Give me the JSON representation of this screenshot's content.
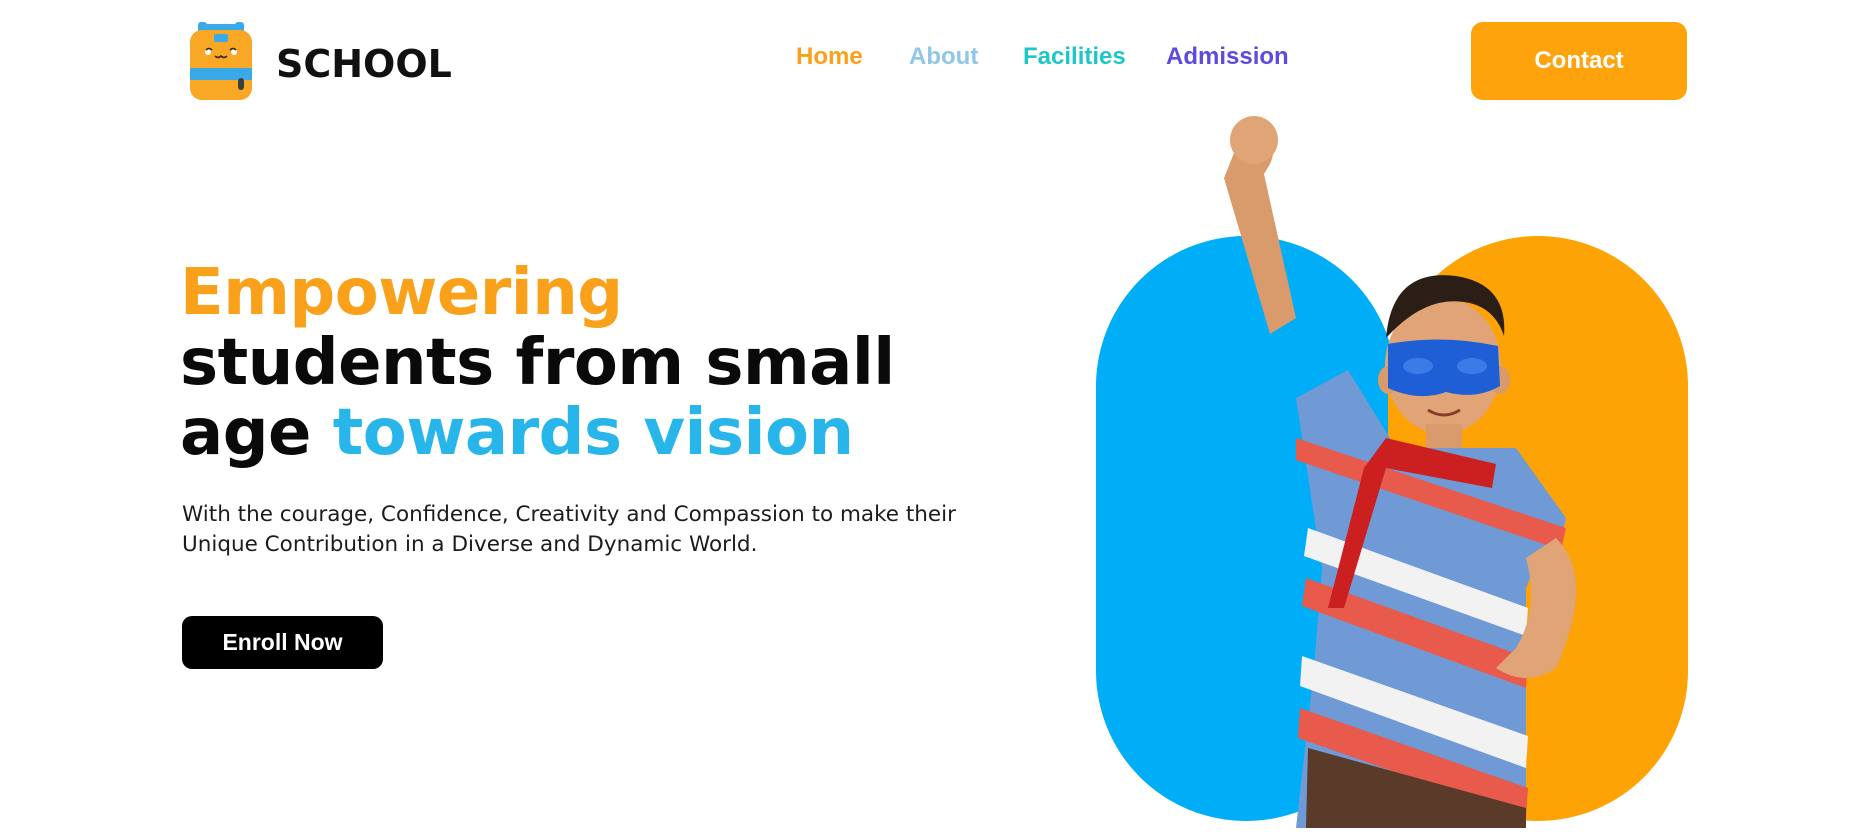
{
  "header": {
    "logo_text": "SCHOOL",
    "logo_icon": "backpack-icon",
    "nav": [
      {
        "label": "Home",
        "color": "#f9a11b"
      },
      {
        "label": "About",
        "color": "#8fc7e4"
      },
      {
        "label": "Facilities",
        "color": "#1fc6c6"
      },
      {
        "label": "Admission",
        "color": "#5b4be0"
      }
    ],
    "contact_label": "Contact",
    "contact_color": "#fea30c"
  },
  "hero": {
    "title_word_1": "Empowering",
    "title_line_2": "students from small",
    "title_line_3_plain": "age",
    "title_line_3_accent": "towards vision",
    "subtitle": "With the courage, Confidence, Creativity and Compassion to make their Unique Contribution in a Diverse and Dynamic World.",
    "cta_label": "Enroll Now",
    "colors": {
      "orange": "#f9a11b",
      "blue": "#28b6ea",
      "pill_blue": "#00adf7",
      "pill_orange": "#fea305"
    }
  }
}
